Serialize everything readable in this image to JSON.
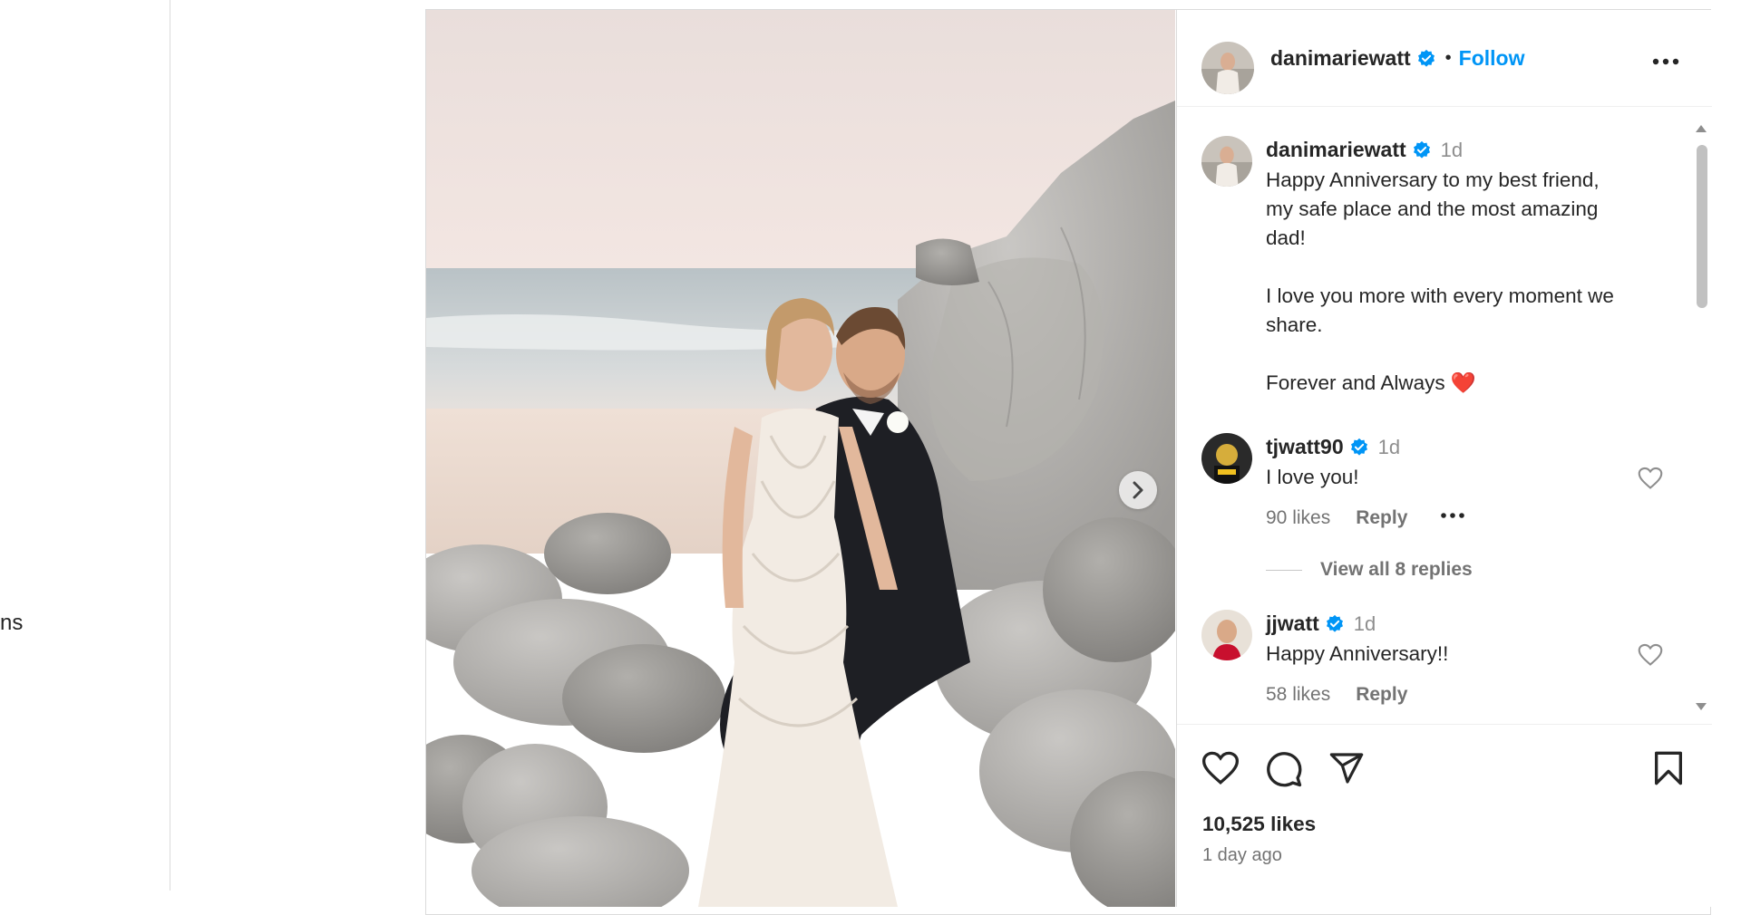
{
  "left_rail": {
    "fragment": "ns"
  },
  "header": {
    "username": "danimariewatt",
    "dot": "•",
    "follow_label": "Follow"
  },
  "caption": {
    "username": "danimariewatt",
    "time": "1d",
    "lines": [
      "Happy Anniversary to my best friend,",
      "my safe place and the most amazing",
      "dad!",
      "I love you more with every moment we",
      "share.",
      "Forever and Always"
    ],
    "emoji": "❤️"
  },
  "comments": [
    {
      "username": "tjwatt90",
      "time": "1d",
      "text": "I love you!",
      "likes": "90 likes",
      "reply": "Reply",
      "view_replies": "View all 8 replies"
    },
    {
      "username": "jjwatt",
      "time": "1d",
      "text": "Happy Anniversary!!",
      "likes": "58 likes",
      "reply": "Reply"
    }
  ],
  "footer": {
    "likes": "10,525 likes",
    "time": "1 day ago"
  },
  "colors": {
    "accent": "#0095f6",
    "verified": "#0095f6",
    "heart_red": "#ed4956"
  }
}
